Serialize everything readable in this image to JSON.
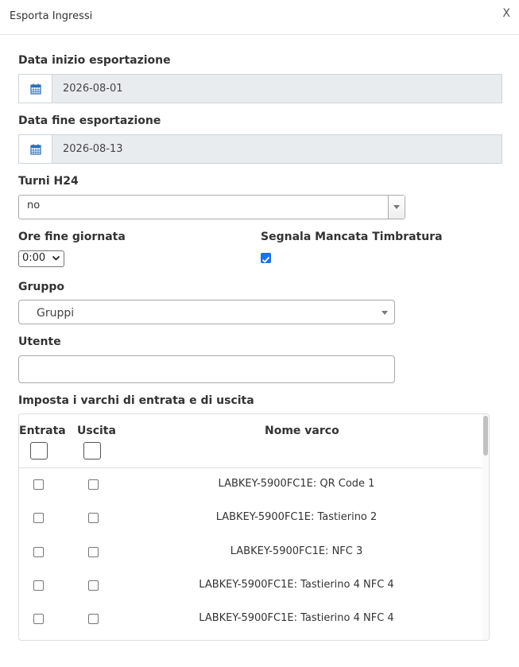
{
  "dialog": {
    "title": "Esporta Ingressi",
    "close_label": "X"
  },
  "form": {
    "start_date": {
      "label": "Data inizio esportazione",
      "value": "2026-08-01",
      "icon": "calendar-icon"
    },
    "end_date": {
      "label": "Data fine esportazione",
      "value": "2026-08-13",
      "icon": "calendar-icon"
    },
    "turni": {
      "label": "Turni H24",
      "value": "no"
    },
    "ore_fine": {
      "label": "Ore fine giornata",
      "value": "0:00"
    },
    "mancata": {
      "label": "Segnala Mancata Timbratura",
      "checked": true
    },
    "gruppo": {
      "label": "Gruppo",
      "value": "Gruppi"
    },
    "utente": {
      "label": "Utente",
      "value": "",
      "placeholder": ""
    },
    "varchi_label": "Imposta i varchi di entrata e di uscita"
  },
  "table": {
    "headers": {
      "entrata": "Entrata",
      "uscita": "Uscita",
      "nome": "Nome varco"
    },
    "rows": [
      {
        "name": "LABKEY-5900FC1E: QR Code 1"
      },
      {
        "name": "LABKEY-5900FC1E: Tastierino 2"
      },
      {
        "name": "LABKEY-5900FC1E: NFC 3"
      },
      {
        "name": "LABKEY-5900FC1E: Tastierino 4 NFC 4"
      },
      {
        "name": "LABKEY-5900FC1E: Tastierino 4 NFC 4"
      }
    ]
  },
  "colors": {
    "accent": "#1a73e8",
    "calendar_icon": "#2c6fb6",
    "disabled_bg": "#e9ecef"
  }
}
